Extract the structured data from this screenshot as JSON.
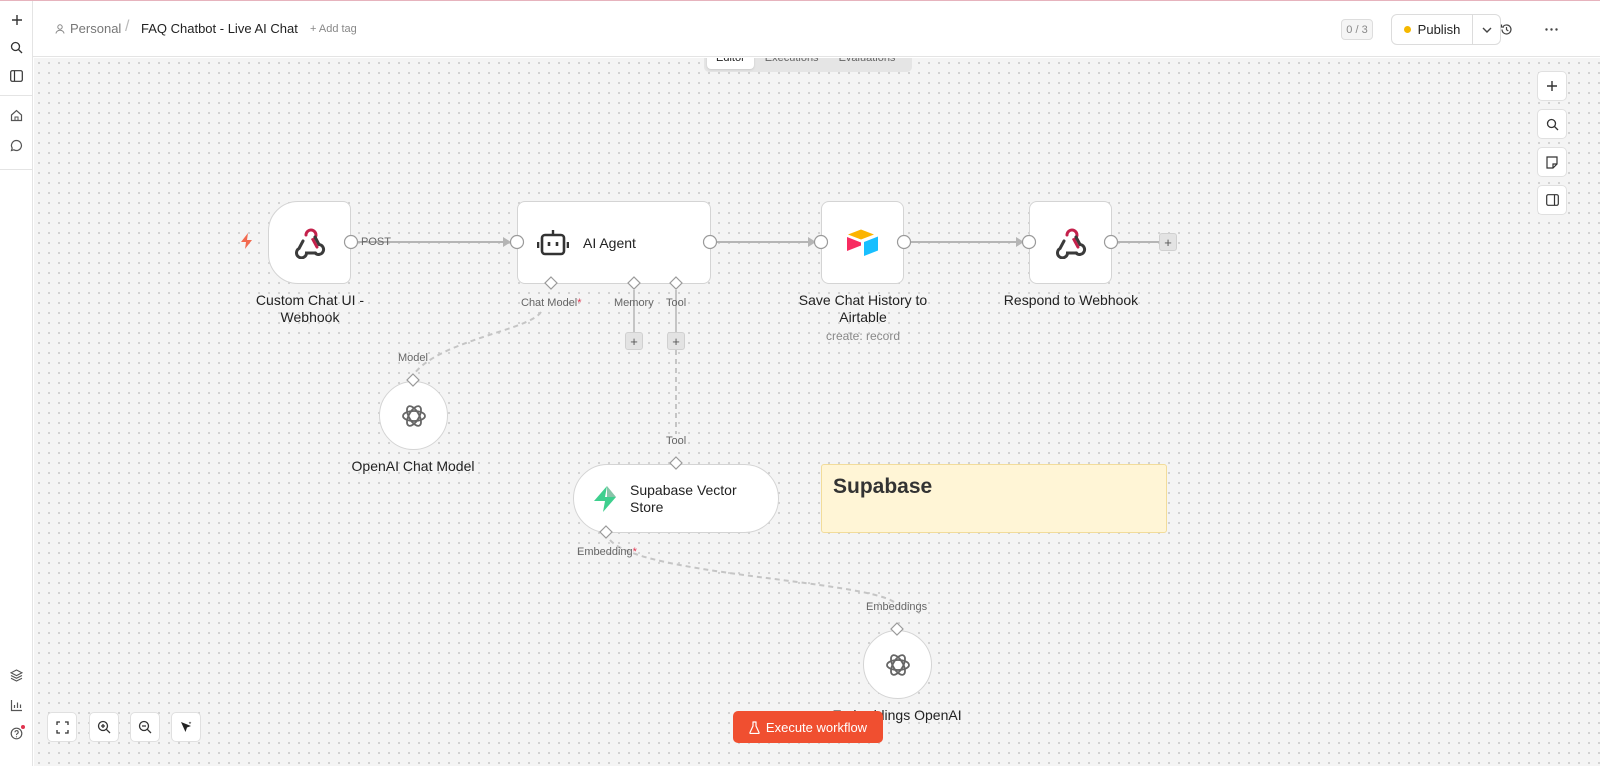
{
  "header": {
    "breadcrumb_owner": "Personal",
    "breadcrumb_separator": "/",
    "workflow_title": "FAQ Chatbot - Live AI Chat",
    "add_tag": "+ Add tag",
    "counter": "0 / 3",
    "publish_label": "Publish"
  },
  "tabs": [
    {
      "label": "Editor",
      "active": true
    },
    {
      "label": "Executions",
      "active": false
    },
    {
      "label": "Evaluations",
      "active": false
    }
  ],
  "nodes": {
    "webhook_trigger": {
      "title": "Custom Chat UI - Webhook",
      "output_label": "POST"
    },
    "ai_agent": {
      "title": "AI Agent",
      "ports": {
        "chat_model": "Chat Model",
        "memory": "Memory",
        "tool": "Tool"
      }
    },
    "airtable": {
      "title": "Save Chat History to Airtable",
      "subtitle": "create: record"
    },
    "respond": {
      "title": "Respond to Webhook"
    },
    "openai_chat": {
      "title": "OpenAI Chat Model",
      "port": "Model"
    },
    "vector_store": {
      "title": "Supabase Vector Store",
      "port_top": "Tool",
      "port_bottom": "Embedding"
    },
    "embeddings": {
      "title": "Embeddings OpenAI",
      "port": "Embeddings"
    }
  },
  "required_marker": "*",
  "sticky_note": {
    "title": "Supabase"
  },
  "execute_button": "Execute workflow",
  "colors": {
    "execute": "#f04f30",
    "publish_dot": "#f5b800",
    "sticky": "#fff5d6",
    "webhook_icon": "#c4214b",
    "supabase_icon": "#3ecf8e"
  },
  "icons": {
    "sidebar": [
      "plus-icon",
      "search-icon",
      "panel-icon",
      "home-icon",
      "chat-icon",
      "templates-icon",
      "insights-icon",
      "help-icon"
    ],
    "canvas_right": [
      "plus-icon",
      "search-icon",
      "sticky-note-icon",
      "panel-icon"
    ],
    "canvas_bottom": [
      "fit-view-icon",
      "zoom-in-icon",
      "zoom-out-icon",
      "tidy-up-icon"
    ]
  }
}
